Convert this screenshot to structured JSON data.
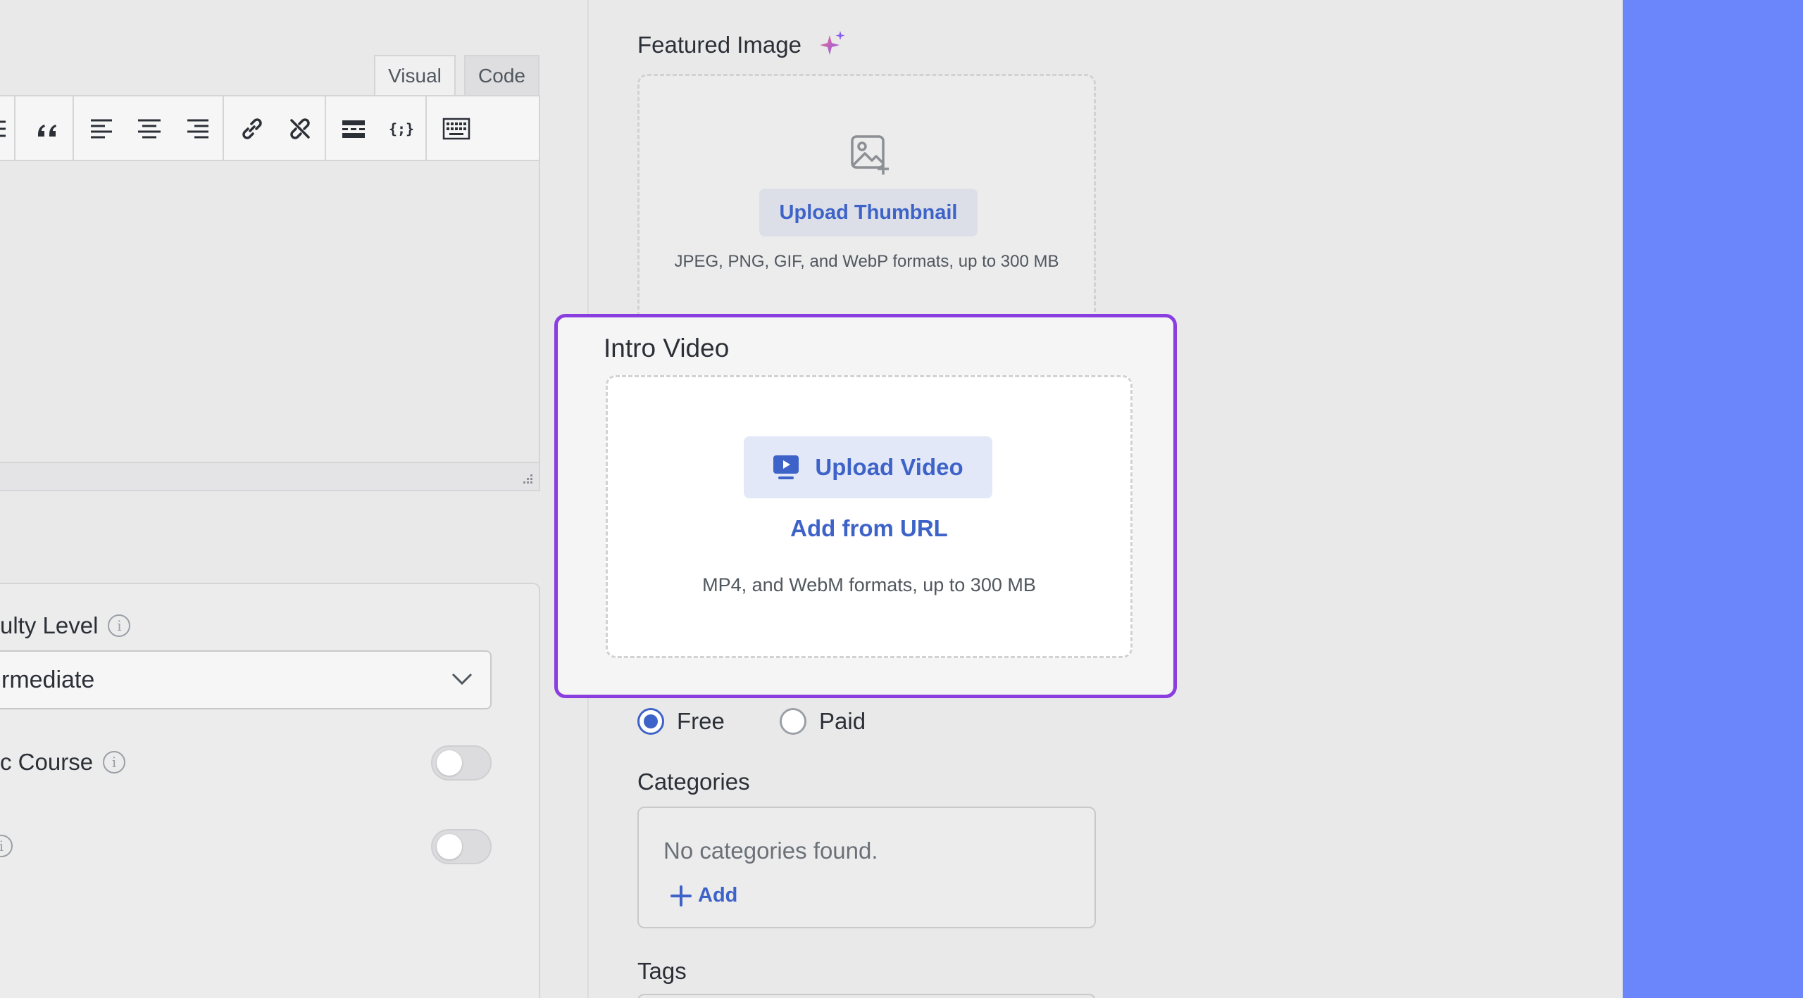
{
  "editor": {
    "tabs": [
      "Visual",
      "Code"
    ],
    "toolbar_icons": [
      "list-icon",
      "blockquote-icon",
      "align-left-icon",
      "align-center-icon",
      "align-right-icon",
      "link-icon",
      "unlink-icon",
      "read-more-icon",
      "code-icon",
      "keyboard-icon"
    ]
  },
  "settings": {
    "difficulty_label": "ulty Level",
    "difficulty_value": "rmediate",
    "public_course_label": "c Course"
  },
  "featured_image": {
    "title": "Featured Image",
    "upload_button": "Upload Thumbnail",
    "hint": "JPEG, PNG, GIF, and WebP formats, up to 300 MB"
  },
  "intro_video": {
    "title": "Intro Video",
    "upload_button": "Upload Video",
    "add_url": "Add from URL",
    "hint": "MP4, and WebM formats, up to 300 MB"
  },
  "pricing": {
    "options": [
      "Free",
      "Paid"
    ],
    "selected": "Free"
  },
  "categories": {
    "title": "Categories",
    "empty_text": "No categories found.",
    "add_label": "Add"
  },
  "tags": {
    "title": "Tags"
  },
  "colors": {
    "accent": "#3e63c8",
    "highlight_border": "#8a3ee0",
    "side_panel": "#6b86fb"
  }
}
